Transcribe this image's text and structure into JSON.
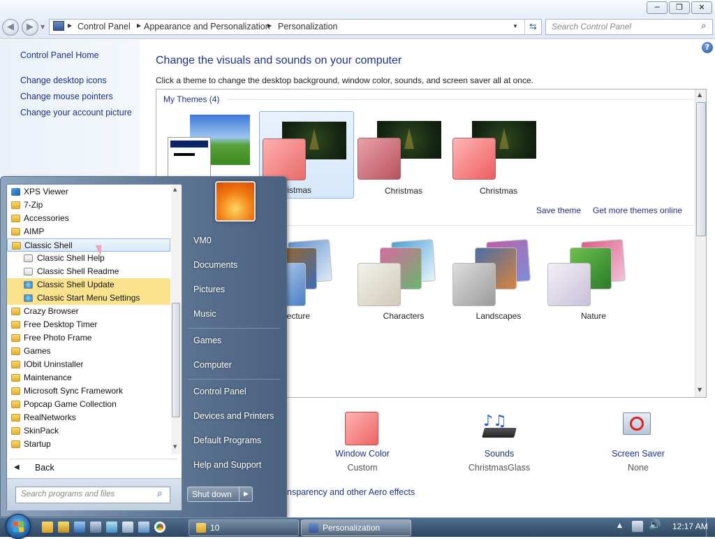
{
  "window": {
    "minimize": "─",
    "restore": "❐",
    "close": "✕"
  },
  "address": {
    "segments": [
      "Control Panel",
      "Appearance and Personalization",
      "Personalization"
    ],
    "search_placeholder": "Search Control Panel"
  },
  "left_pane": {
    "home": "Control Panel Home",
    "links": [
      "Change desktop icons",
      "Change mouse pointers",
      "Change your account picture"
    ]
  },
  "main": {
    "title": "Change the visuals and sounds on your computer",
    "description": "Click a theme to change the desktop background, window color, sounds, and screen saver all at once.",
    "my_themes_header": "My Themes (4)",
    "my_themes": [
      "Christmas",
      "Christmas",
      "Christmas"
    ],
    "save_theme": "Save theme",
    "get_more": "Get more themes online",
    "aero_themes": [
      "Architecture",
      "Characters",
      "Landscapes",
      "Nature"
    ],
    "window_color": {
      "title": "Window Color",
      "value": "Custom"
    },
    "sounds": {
      "title": "Sounds",
      "value": "ChristmasGlass"
    },
    "screen_saver": {
      "title": "Screen Saver",
      "value": "None"
    },
    "aero_link": "nsparency and other Aero effects"
  },
  "start_menu": {
    "programs": [
      {
        "label": "XPS Viewer",
        "kind": "app"
      },
      {
        "label": "7-Zip",
        "kind": "folder"
      },
      {
        "label": "Accessories",
        "kind": "folder"
      },
      {
        "label": "AIMP",
        "kind": "folder"
      },
      {
        "label": "Classic Shell",
        "kind": "folder-open"
      },
      {
        "label": "Classic Shell Help",
        "kind": "sub"
      },
      {
        "label": "Classic Shell Readme",
        "kind": "sub"
      },
      {
        "label": "Classic Shell Update",
        "kind": "sub-new"
      },
      {
        "label": "Classic Start Menu Settings",
        "kind": "sub-new"
      },
      {
        "label": "Crazy Browser",
        "kind": "folder"
      },
      {
        "label": "Free Desktop Timer",
        "kind": "folder"
      },
      {
        "label": "Free Photo Frame",
        "kind": "folder"
      },
      {
        "label": "Games",
        "kind": "folder"
      },
      {
        "label": "IObit Uninstaller",
        "kind": "folder"
      },
      {
        "label": "Maintenance",
        "kind": "folder"
      },
      {
        "label": "Microsoft Sync Framework",
        "kind": "folder"
      },
      {
        "label": "Popcap Game Collection",
        "kind": "folder"
      },
      {
        "label": "RealNetworks",
        "kind": "folder"
      },
      {
        "label": "SkinPack",
        "kind": "folder"
      },
      {
        "label": "Startup",
        "kind": "folder"
      }
    ],
    "back": "Back",
    "search_placeholder": "Search programs and files",
    "right_items": [
      "VM0",
      "Documents",
      "Pictures",
      "Music",
      "Games",
      "Computer",
      "Control Panel",
      "Devices and Printers",
      "Default Programs",
      "Help and Support"
    ],
    "shutdown": "Shut down"
  },
  "taskbar": {
    "buttons": [
      "10",
      "Personalization"
    ],
    "clock": "12:17 AM"
  }
}
